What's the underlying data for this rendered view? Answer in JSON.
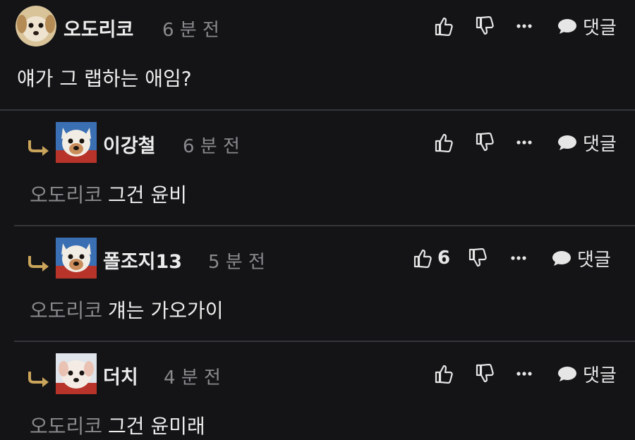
{
  "colors": {
    "background": "#141416",
    "separator": "#35363a",
    "muted_text": "#8a8a8e",
    "primary_text": "#eeeeee",
    "reply_arrow": "#c9a45a"
  },
  "action_labels": {
    "reply": "댓글"
  },
  "comments": [
    {
      "author": "오도리코",
      "time": "6 분 전",
      "avatar_icon": "dog-avatar-icon",
      "is_reply": false,
      "mention": "",
      "text": "얘가 그 랩하는 애임?",
      "likes": ""
    },
    {
      "author": "이강철",
      "time": "6 분 전",
      "avatar_icon": "dog-avatar-icon",
      "is_reply": true,
      "mention": "오도리코",
      "text": "그건 윤비",
      "likes": ""
    },
    {
      "author": "폴조지13",
      "time": "5 분 전",
      "avatar_icon": "dog-avatar-icon",
      "is_reply": true,
      "mention": "오도리코",
      "text": "걔는 가오가이",
      "likes": "6"
    },
    {
      "author": "더치",
      "time": "4 분 전",
      "avatar_icon": "dog-avatar-icon",
      "is_reply": true,
      "mention": "오도리코",
      "text": "그건 윤미래",
      "likes": ""
    }
  ]
}
